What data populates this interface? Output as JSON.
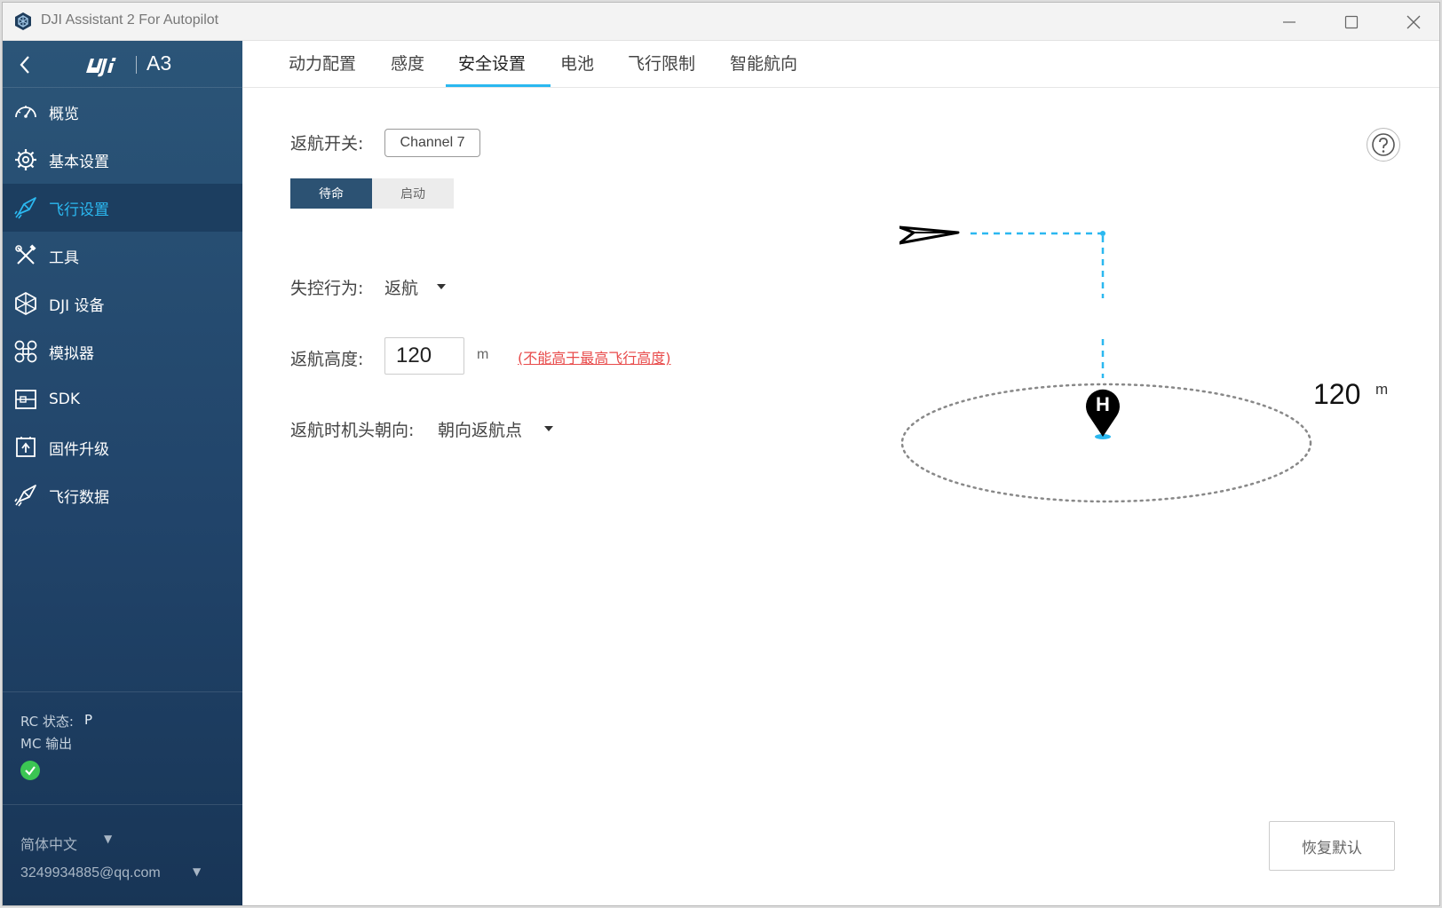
{
  "window": {
    "title": "DJI Assistant 2 For Autopilot"
  },
  "sidebar": {
    "model": "A3",
    "items": [
      {
        "label": "概览",
        "icon": "gauge-icon"
      },
      {
        "label": "基本设置",
        "icon": "gear-icon"
      },
      {
        "label": "飞行设置",
        "icon": "rocket-icon",
        "active": true
      },
      {
        "label": "工具",
        "icon": "tools-icon"
      },
      {
        "label": "DJI 设备",
        "icon": "device-icon"
      },
      {
        "label": "模拟器",
        "icon": "simulator-icon"
      },
      {
        "label": "SDK",
        "icon": "sdk-icon"
      },
      {
        "label": "固件升级",
        "icon": "firmware-icon"
      },
      {
        "label": "飞行数据",
        "icon": "flight-data-icon"
      }
    ],
    "status": {
      "rc_label": "RC 状态:",
      "rc_value": "P",
      "mc_label": "MC 输出"
    },
    "language": "简体中文",
    "account": "3249934885@qq.com"
  },
  "tabs": [
    {
      "label": "动力配置"
    },
    {
      "label": "感度"
    },
    {
      "label": "安全设置",
      "active": true
    },
    {
      "label": "电池"
    },
    {
      "label": "飞行限制"
    },
    {
      "label": "智能航向"
    }
  ],
  "safety": {
    "rth_switch_label": "返航开关:",
    "rth_channel": "Channel 7",
    "segment": {
      "standby": "待命",
      "start": "启动",
      "selected": "待命"
    },
    "failsafe_label": "失控行为:",
    "failsafe_value": "返航",
    "rth_altitude_label": "返航高度:",
    "rth_altitude_value": "120",
    "rth_altitude_unit": "m",
    "rth_altitude_warning": "(不能高于最高飞行高度)",
    "heading_label": "返航时机头朝向:",
    "heading_value": "朝向返航点"
  },
  "diagram": {
    "altitude": "120",
    "unit": "m",
    "home_marker": "H"
  },
  "buttons": {
    "reset": "恢复默认"
  },
  "colors": {
    "accent": "#2bb8f0",
    "sidebar_top": "#2b5578",
    "sidebar_bottom": "#183556",
    "warning": "#e84a4a",
    "ok": "#3bc553"
  }
}
